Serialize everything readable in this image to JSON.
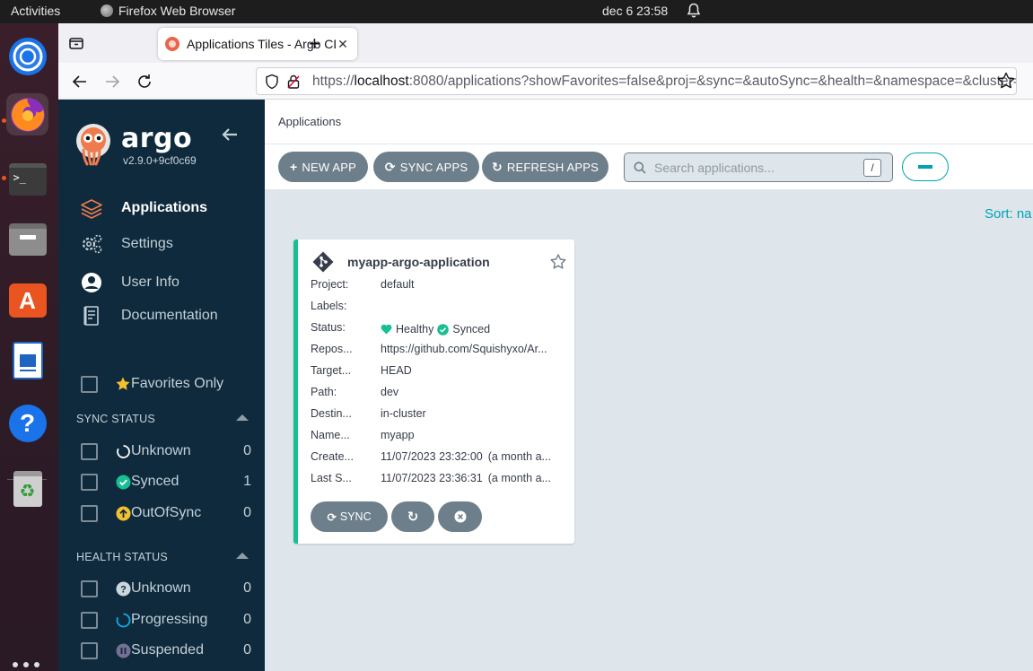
{
  "topbar": {
    "activities": "Activities",
    "app_name": "Firefox Web Browser",
    "clock": "dec 6  23:58"
  },
  "browser": {
    "tab_title": "Applications Tiles - Argo CD",
    "url_prefix": "https://",
    "url_host": "localhost",
    "url_rest": ":8080/applications?showFavorites=false&proj=&sync=&autoSync=&health=&namespace=&cluster="
  },
  "sidebar": {
    "brand": "argo",
    "version": "v2.9.0+9cf0c69",
    "nav": [
      {
        "label": "Applications",
        "icon": "layers-icon"
      },
      {
        "label": "Settings",
        "icon": "gears-icon"
      },
      {
        "label": "User Info",
        "icon": "user-circle-icon"
      },
      {
        "label": "Documentation",
        "icon": "book-icon"
      }
    ],
    "favorites_label": "Favorites Only",
    "sync_status": {
      "heading": "SYNC STATUS",
      "items": [
        {
          "label": "Unknown",
          "count": "0"
        },
        {
          "label": "Synced",
          "count": "1"
        },
        {
          "label": "OutOfSync",
          "count": "0"
        }
      ]
    },
    "health_status": {
      "heading": "HEALTH STATUS",
      "items": [
        {
          "label": "Unknown",
          "count": "0"
        },
        {
          "label": "Progressing",
          "count": "0"
        },
        {
          "label": "Suspended",
          "count": "0"
        }
      ]
    }
  },
  "main": {
    "header_title": "Applications",
    "toolbar": {
      "new_app": "NEW APP",
      "sync_apps": "SYNC APPS",
      "refresh_apps": "REFRESH APPS",
      "search_placeholder": "Search applications...",
      "search_shortcut": "/"
    },
    "sort_label": "Sort: na"
  },
  "app_card": {
    "name": "myapp-argo-application",
    "fields": [
      {
        "key": "Project:",
        "value": "default"
      },
      {
        "key": "Labels:",
        "value": ""
      },
      {
        "key": "Repos...",
        "value": "https://github.com/Squishyxo/Ar..."
      },
      {
        "key": "Target...",
        "value": "HEAD"
      },
      {
        "key": "Path:",
        "value": "dev"
      },
      {
        "key": "Destin...",
        "value": "in-cluster"
      },
      {
        "key": "Name...",
        "value": "myapp"
      },
      {
        "key": "Create...",
        "value": "11/07/2023 23:32:00",
        "sub": "(a month a..."
      },
      {
        "key": "Last S...",
        "value": "11/07/2023 23:36:31",
        "sub": "(a month a..."
      }
    ],
    "status_key": "Status:",
    "health": "Healthy",
    "sync": "Synced",
    "sync_button": "SYNC"
  },
  "colors": {
    "sidebar_bg": "#0e2a3c",
    "healthy": "#18be94",
    "accent": "#00a2b3",
    "button": "#6d7f8b",
    "out_of_sync": "#f4c030"
  }
}
